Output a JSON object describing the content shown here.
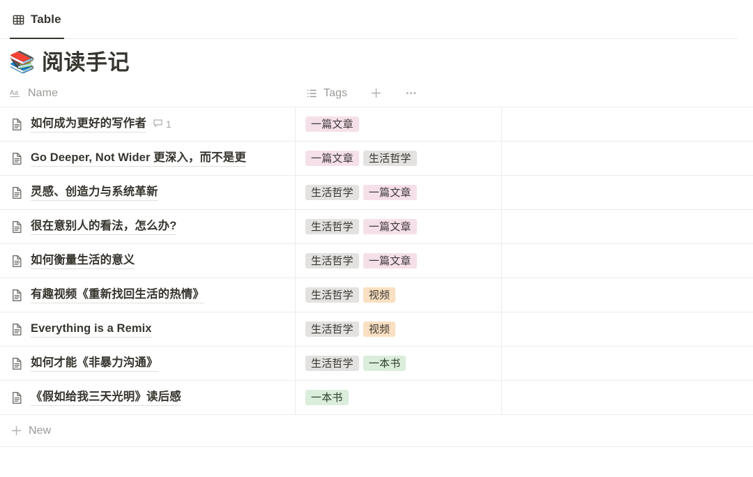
{
  "view_tabs": [
    {
      "label": "Table",
      "icon": "table-grid-icon",
      "active": true
    }
  ],
  "page": {
    "emoji": "📚",
    "emoji_name": "books-emoji",
    "title": "阅读手记"
  },
  "table": {
    "columns": [
      {
        "id": "name",
        "label": "Name",
        "icon": "text-aa-icon"
      },
      {
        "id": "tags",
        "label": "Tags",
        "icon": "multi-select-list-icon"
      }
    ],
    "header_actions": [
      {
        "name": "add-column-button",
        "glyph": "+"
      },
      {
        "name": "column-options-button",
        "glyph": "•••"
      }
    ],
    "tag_colors": {
      "一篇文章": {
        "bg": "#f5e0e9",
        "fg": "#3f3a3c"
      },
      "生活哲学": {
        "bg": "#e3e2e0",
        "fg": "#37352f"
      },
      "视频": {
        "bg": "#fae0c2",
        "fg": "#3f3a34"
      },
      "一本书": {
        "bg": "#dbeddb",
        "fg": "#2f3e2f"
      }
    },
    "rows": [
      {
        "name": "如何成为更好的写作者",
        "truncated": false,
        "comments": "1",
        "tags": [
          "一篇文章"
        ]
      },
      {
        "name": "Go Deeper, Not Wider 更深入，而不是更",
        "truncated": true,
        "comments": null,
        "tags": [
          "一篇文章",
          "生活哲学"
        ]
      },
      {
        "name": "灵感、创造力与系统革新",
        "truncated": false,
        "comments": null,
        "tags": [
          "生活哲学",
          "一篇文章"
        ]
      },
      {
        "name": "很在意别人的看法，怎么办?",
        "truncated": false,
        "comments": null,
        "tags": [
          "生活哲学",
          "一篇文章"
        ]
      },
      {
        "name": "如何衡量生活的意义",
        "truncated": false,
        "comments": null,
        "tags": [
          "生活哲学",
          "一篇文章"
        ]
      },
      {
        "name": "有趣视频《重新找回生活的热情》",
        "truncated": false,
        "comments": null,
        "tags": [
          "生活哲学",
          "视频"
        ]
      },
      {
        "name": "Everything is a Remix",
        "truncated": false,
        "comments": null,
        "tags": [
          "生活哲学",
          "视频"
        ]
      },
      {
        "name": "如何才能《非暴力沟通》",
        "truncated": false,
        "comments": null,
        "tags": [
          "生活哲学",
          "一本书"
        ]
      },
      {
        "name": "《假如给我三天光明》读后感",
        "truncated": false,
        "comments": null,
        "tags": [
          "一本书"
        ]
      }
    ],
    "new_row": {
      "label": "New",
      "glyph": "+"
    }
  }
}
